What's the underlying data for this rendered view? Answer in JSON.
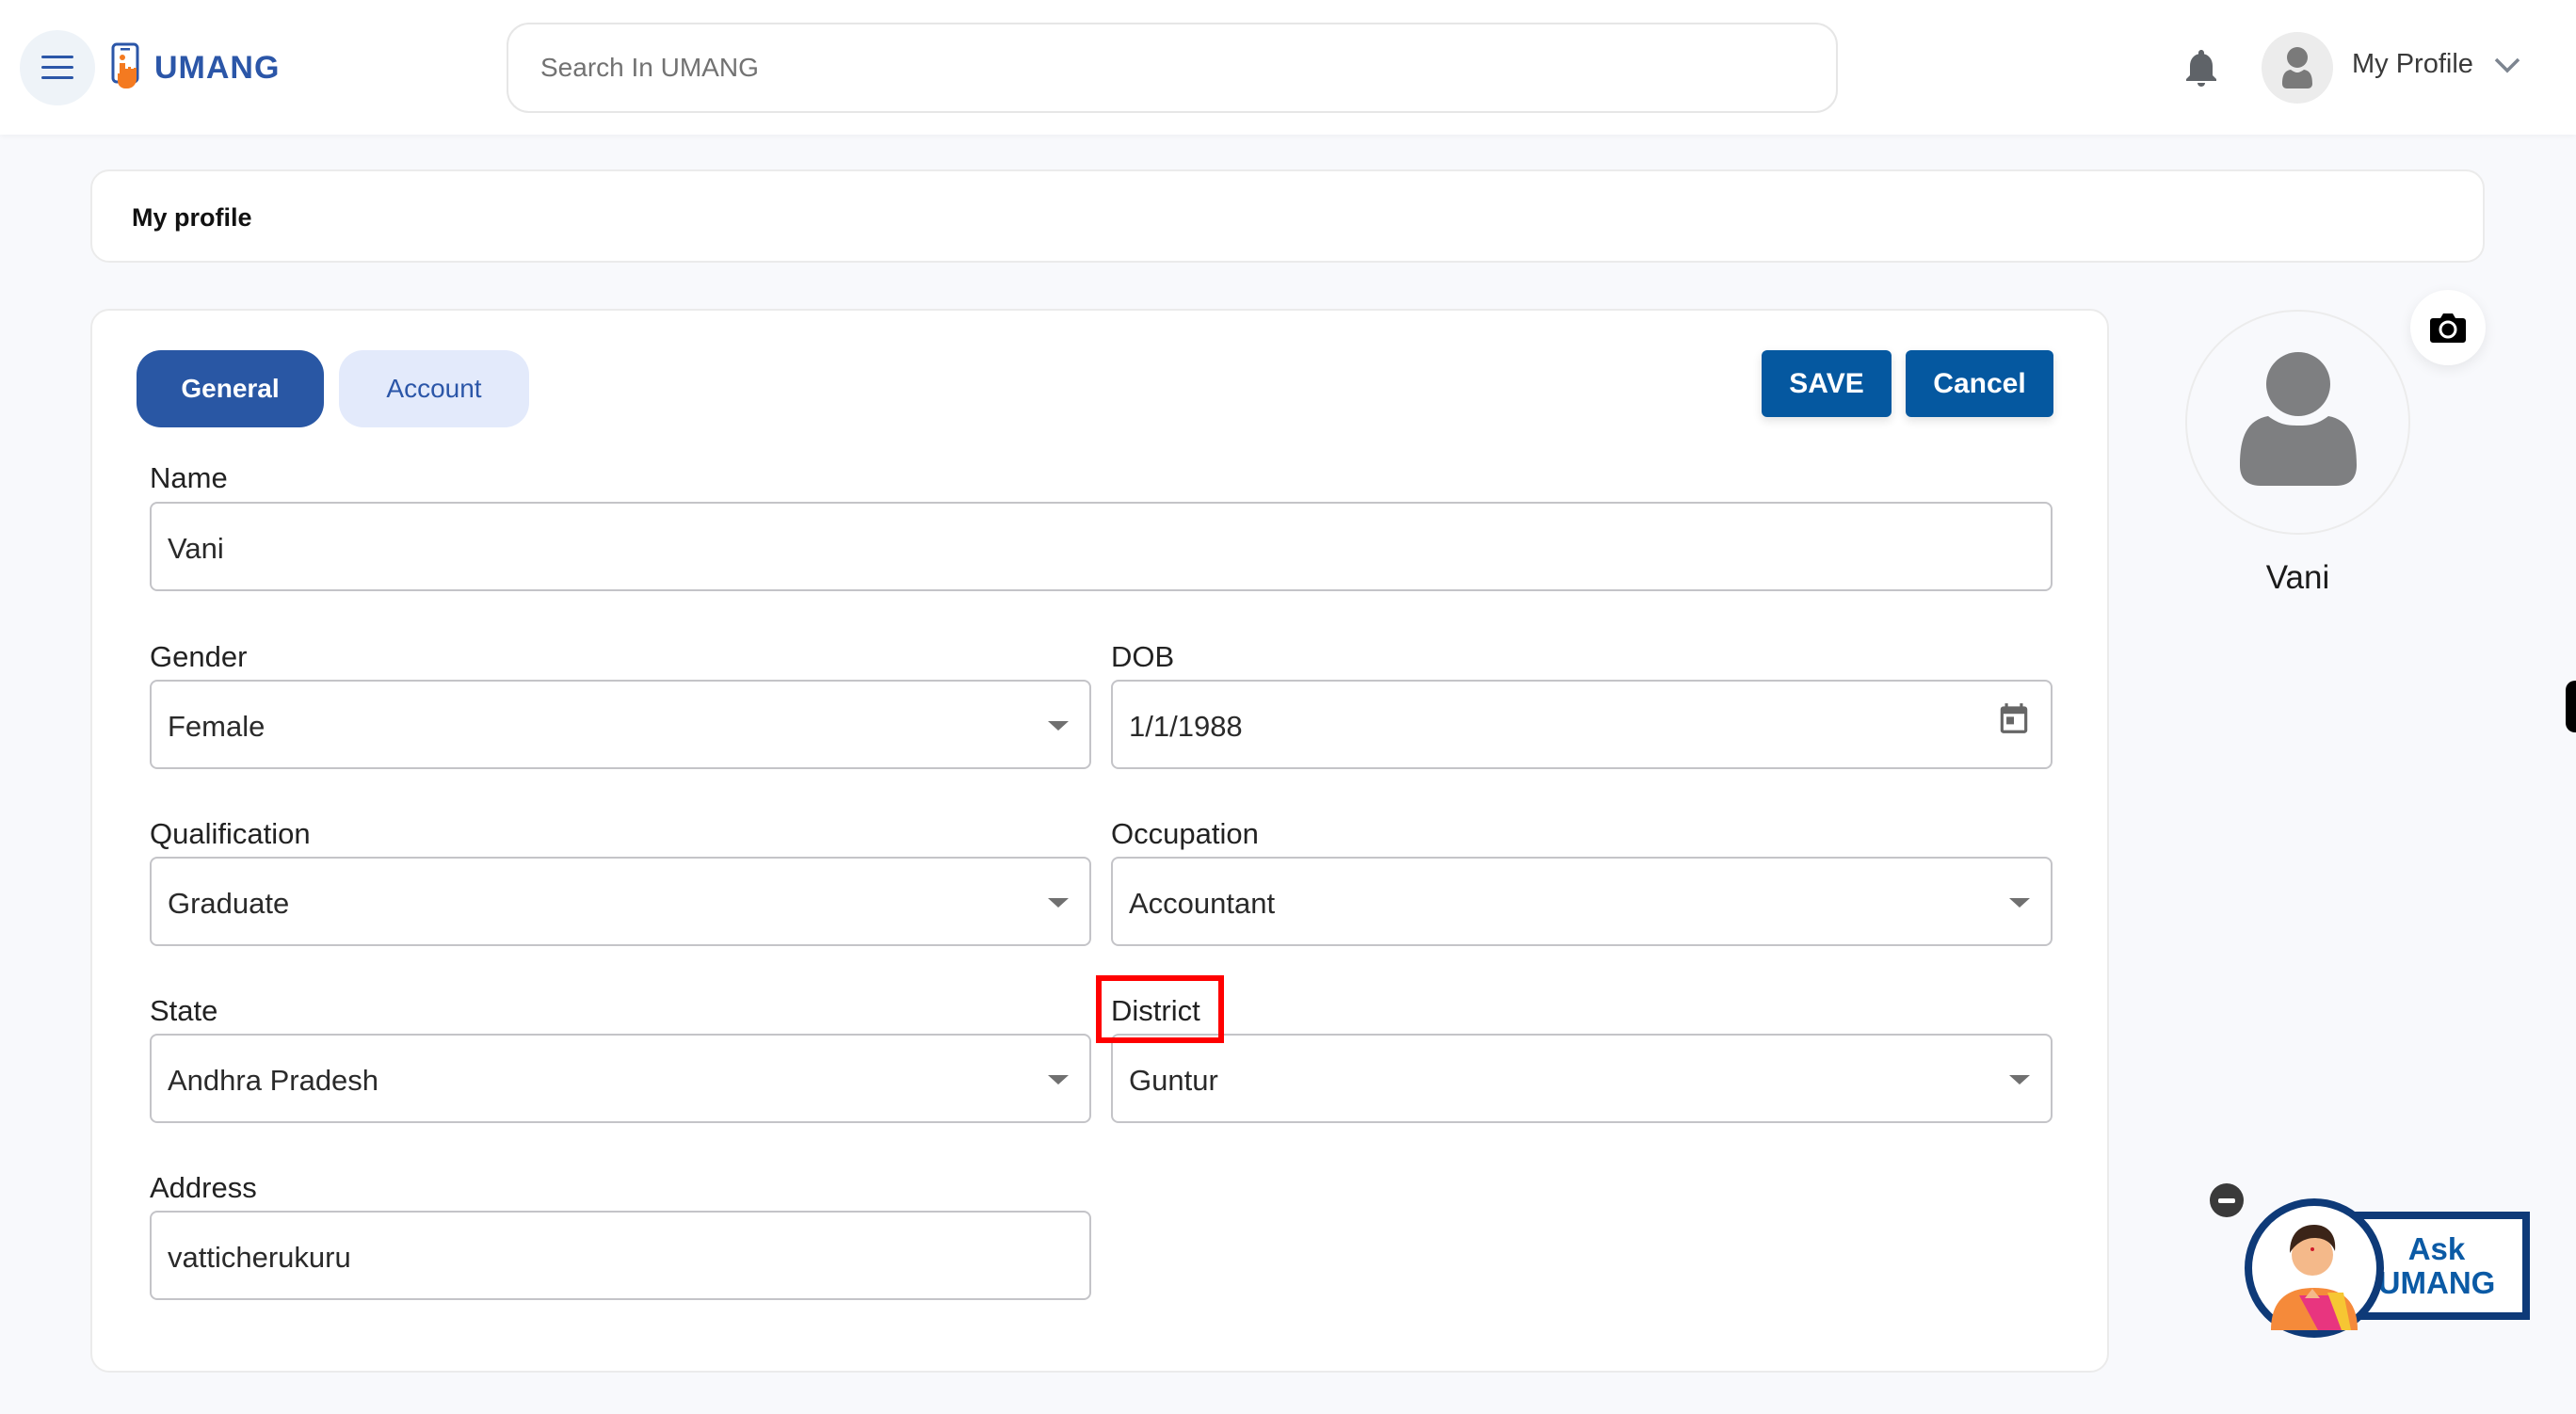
{
  "header": {
    "logo_text": "UMANG",
    "search_placeholder": "Search In UMANG",
    "profile_label": "My Profile"
  },
  "breadcrumb": {
    "title": "My profile"
  },
  "tabs": [
    {
      "label": "General",
      "active": true
    },
    {
      "label": "Account",
      "active": false
    }
  ],
  "actions": {
    "save_label": "SAVE",
    "cancel_label": "Cancel"
  },
  "form": {
    "name": {
      "label": "Name",
      "value": "Vani"
    },
    "gender": {
      "label": "Gender",
      "value": "Female"
    },
    "dob": {
      "label": "DOB",
      "value": "1/1/1988"
    },
    "qualification": {
      "label": "Qualification",
      "value": "Graduate"
    },
    "occupation": {
      "label": "Occupation",
      "value": "Accountant"
    },
    "state": {
      "label": "State",
      "value": "Andhra Pradesh"
    },
    "district": {
      "label": "District",
      "value": "Guntur"
    },
    "address": {
      "label": "Address",
      "value": "vatticherukuru"
    }
  },
  "profile_panel": {
    "display_name": "Vani"
  },
  "assistant": {
    "line1": "Ask",
    "line2": "UMANG"
  },
  "colors": {
    "brand_blue": "#2b56a8",
    "button_blue": "#0558a0",
    "accent_orange": "#f47a20",
    "highlight_red": "#ff0000"
  }
}
